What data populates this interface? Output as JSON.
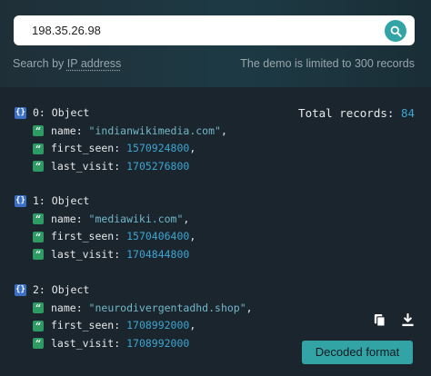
{
  "search": {
    "value": "198.35.26.98",
    "hint_prefix": "Search by ",
    "hint_link": "IP address",
    "limit_note": "The demo is limited to 300 records"
  },
  "results": {
    "total_label": "Total records: ",
    "total_value": "84",
    "records": [
      {
        "header": "0: Object",
        "name_key": "name: ",
        "name": "\"indianwikimedia.com\"",
        "first_seen_key": "first_seen: ",
        "first_seen": "1570924800",
        "last_visit_key": "last_visit: ",
        "last_visit": "1705276800"
      },
      {
        "header": "1: Object",
        "name_key": "name: ",
        "name": "\"mediawiki.com\"",
        "first_seen_key": "first_seen: ",
        "first_seen": "1570406400",
        "last_visit_key": "last_visit: ",
        "last_visit": "1704844800"
      },
      {
        "header": "2: Object",
        "name_key": "name: ",
        "name": "\"neurodivergentadhd.shop\"",
        "first_seen_key": "first_seen: ",
        "first_seen": "1708992000",
        "last_visit_key": "last_visit: ",
        "last_visit": "1708992000"
      }
    ],
    "comma": ","
  },
  "icons": {
    "object": "{}",
    "string": "“",
    "search": "search-icon",
    "copy": "copy-icon",
    "download": "download-icon"
  },
  "actions": {
    "decoded_label": "Decoded format"
  },
  "colors": {
    "accent": "#33a4a6",
    "number": "#3ca6d0",
    "string": "#72b8c9",
    "object_badge": "#3b6fc4",
    "string_badge": "#2e9a64"
  }
}
